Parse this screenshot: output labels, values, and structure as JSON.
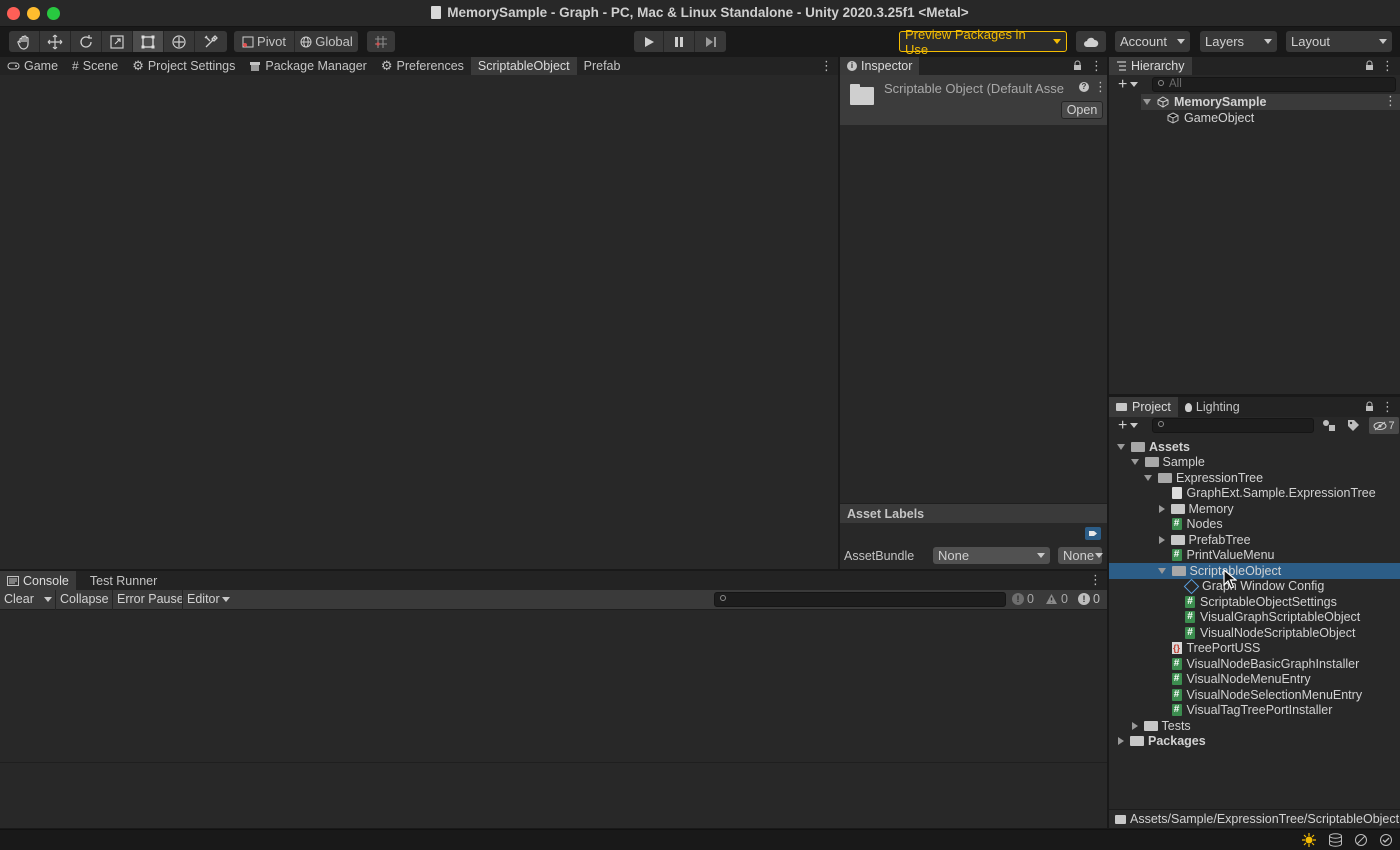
{
  "window": {
    "title": "MemorySample - Graph - PC, Mac & Linux Standalone - Unity 2020.3.25f1 <Metal>"
  },
  "toolbar": {
    "pivot_label": "Pivot",
    "global_label": "Global",
    "preview_packages_label": "Preview Packages in Use",
    "account_label": "Account",
    "layers_label": "Layers",
    "layout_label": "Layout"
  },
  "scene_tabs": [
    "Game",
    "Scene",
    "Project Settings",
    "Package Manager",
    "Preferences",
    "ScriptableObject",
    "Prefab"
  ],
  "inspector": {
    "tab_label": "Inspector",
    "object_title": "Scriptable Object (Default Asse",
    "open_label": "Open",
    "asset_labels_title": "Asset Labels",
    "assetbundle_label": "AssetBundle",
    "assetbundle_value": "None",
    "variant_value": "None"
  },
  "hierarchy": {
    "tab_label": "Hierarchy",
    "search_placeholder": "All",
    "scene_name": "MemorySample",
    "children": [
      "GameObject"
    ]
  },
  "project": {
    "tabs": [
      "Project",
      "Lighting"
    ],
    "hidden_count": "7",
    "tree": [
      {
        "label": "Assets",
        "kind": "folder-open",
        "depth": 0,
        "arrow": "down"
      },
      {
        "label": "Sample",
        "kind": "folder-open",
        "depth": 1,
        "arrow": "down"
      },
      {
        "label": "ExpressionTree",
        "kind": "folder-open",
        "depth": 2,
        "arrow": "down"
      },
      {
        "label": "GraphExt.Sample.ExpressionTree",
        "kind": "asmdef",
        "depth": 3,
        "arrow": "none"
      },
      {
        "label": "Memory",
        "kind": "folder",
        "depth": 3,
        "arrow": "right"
      },
      {
        "label": "Nodes",
        "kind": "script",
        "depth": 3,
        "arrow": "none"
      },
      {
        "label": "PrefabTree",
        "kind": "folder",
        "depth": 3,
        "arrow": "right"
      },
      {
        "label": "PrintValueMenu",
        "kind": "script",
        "depth": 3,
        "arrow": "none"
      },
      {
        "label": "ScriptableObject",
        "kind": "folder-open",
        "depth": 3,
        "arrow": "down",
        "selected": true
      },
      {
        "label": "Graph Window Config",
        "kind": "so",
        "depth": 4,
        "arrow": "none"
      },
      {
        "label": "ScriptableObjectSettings",
        "kind": "script",
        "depth": 4,
        "arrow": "none"
      },
      {
        "label": "VisualGraphScriptableObject",
        "kind": "script",
        "depth": 4,
        "arrow": "none"
      },
      {
        "label": "VisualNodeScriptableObject",
        "kind": "script",
        "depth": 4,
        "arrow": "none"
      },
      {
        "label": "TreePortUSS",
        "kind": "uss",
        "depth": 3,
        "arrow": "none"
      },
      {
        "label": "VisualNodeBasicGraphInstaller",
        "kind": "script",
        "depth": 3,
        "arrow": "none"
      },
      {
        "label": "VisualNodeMenuEntry",
        "kind": "script",
        "depth": 3,
        "arrow": "none"
      },
      {
        "label": "VisualNodeSelectionMenuEntry",
        "kind": "script",
        "depth": 3,
        "arrow": "none"
      },
      {
        "label": "VisualTagTreePortInstaller",
        "kind": "script",
        "depth": 3,
        "arrow": "none"
      },
      {
        "label": "Tests",
        "kind": "folder",
        "depth": 1,
        "arrow": "right"
      },
      {
        "label": "Packages",
        "kind": "folder",
        "depth": 0,
        "arrow": "right"
      }
    ],
    "path": "Assets/Sample/ExpressionTree/ScriptableObject"
  },
  "console": {
    "tabs": [
      "Console",
      "Test Runner"
    ],
    "clear_label": "Clear",
    "collapse_label": "Collapse",
    "error_pause_label": "Error Pause",
    "editor_label": "Editor",
    "log_count": "0",
    "warning_count": "0",
    "error_count": "0"
  },
  "colors": {
    "selection": "#2c5d87",
    "preview_packages": "#f4bc02",
    "panel": "#282828"
  }
}
